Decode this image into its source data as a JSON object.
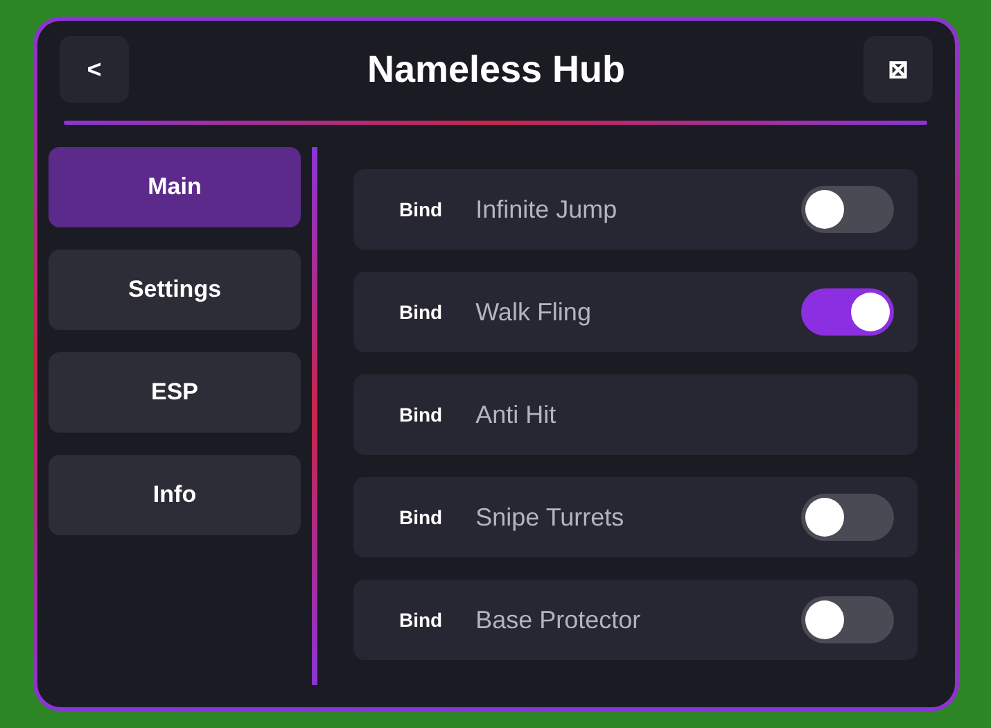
{
  "window": {
    "title": "Nameless Hub",
    "back_button": "<",
    "close_button": "⊠"
  },
  "sidebar": {
    "items": [
      {
        "label": "Main",
        "selected": true
      },
      {
        "label": "Settings",
        "selected": false
      },
      {
        "label": "ESP",
        "selected": false
      },
      {
        "label": "Info",
        "selected": false
      }
    ]
  },
  "features": [
    {
      "kind": "toggle",
      "bind": "Bind",
      "label": "Infinite Jump",
      "on": false
    },
    {
      "kind": "toggle",
      "bind": "Bind",
      "label": "Walk Fling",
      "on": true
    },
    {
      "kind": "button",
      "bind": "Bind",
      "label": "Anti Hit"
    },
    {
      "kind": "toggle",
      "bind": "Bind",
      "label": "Snipe Turrets",
      "on": false
    },
    {
      "kind": "toggle",
      "bind": "Bind",
      "label": "Base Protector",
      "on": false
    }
  ]
}
